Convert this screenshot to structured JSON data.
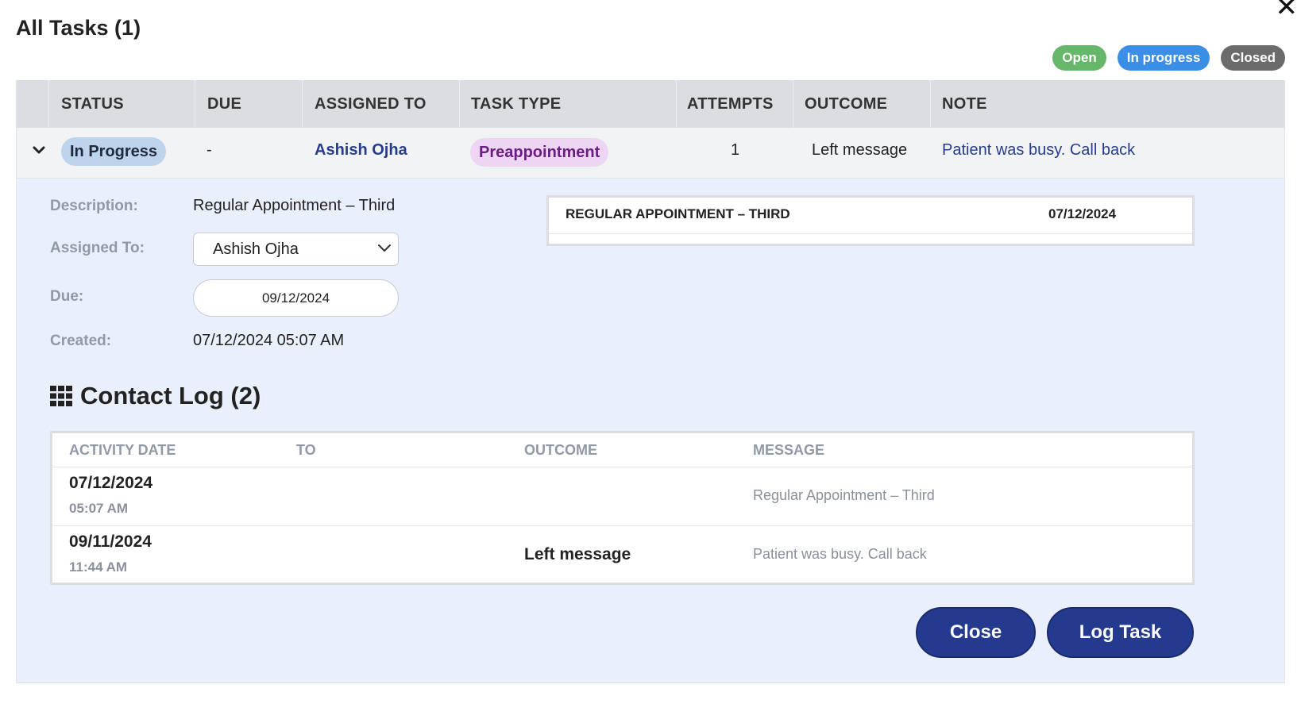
{
  "dialog": {
    "title": "All Tasks (1)",
    "close_icon": "close-icon"
  },
  "legend": [
    {
      "label": "Open",
      "color": "#66b76a"
    },
    {
      "label": "In progress",
      "color": "#3a8ee6"
    },
    {
      "label": "Closed",
      "color": "#6b6b6b"
    }
  ],
  "columns": {
    "status": "STATUS",
    "due": "DUE",
    "assigned_to": "ASSIGNED TO",
    "task_type": "TASK TYPE",
    "attempts": "ATTEMPTS",
    "outcome": "OUTCOME",
    "note": "NOTE"
  },
  "task": {
    "status": "In Progress",
    "due": "-",
    "assigned_to": "Ashish Ojha",
    "task_type": "Preappointment",
    "attempts": "1",
    "outcome": "Left message",
    "note": "Patient was busy. Call back"
  },
  "details": {
    "description_label": "Description:",
    "description_value": "Regular Appointment – Third",
    "assigned_label": "Assigned To:",
    "assigned_value": "Ashish Ojha",
    "due_label": "Due:",
    "due_value": "09/12/2024",
    "created_label": "Created:",
    "created_value": "07/12/2024 05:07 AM"
  },
  "side_card": {
    "title": "REGULAR APPOINTMENT – THIRD",
    "date": "07/12/2024"
  },
  "contact_log": {
    "title": "Contact Log (2)",
    "icon": "grid-icon",
    "headers": {
      "activity_date": "ACTIVITY DATE",
      "to": "TO",
      "outcome": "OUTCOME",
      "message": "MESSAGE"
    },
    "rows": [
      {
        "date": "07/12/2024",
        "time": "05:07 AM",
        "to": "",
        "outcome": "",
        "message": "Regular Appointment – Third"
      },
      {
        "date": "09/11/2024",
        "time": "11:44 AM",
        "to": "",
        "outcome": "Left message",
        "message": "Patient was busy. Call back"
      }
    ]
  },
  "buttons": {
    "close": "Close",
    "log_task": "Log Task"
  },
  "colors": {
    "primary": "#243a8f",
    "panel_bg": "#eaf0fb",
    "status_pill": "#bed3ec",
    "type_pill": "#edd5f3"
  }
}
